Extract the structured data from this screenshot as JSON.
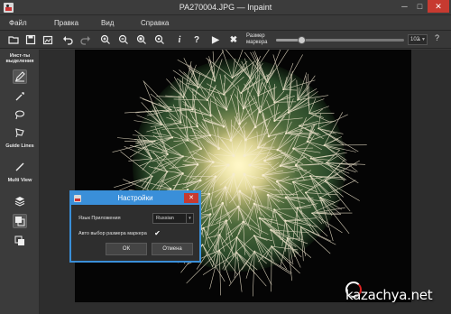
{
  "window": {
    "title": "PA270004.JPG — Inpaint",
    "min_glyph": "─",
    "max_glyph": "□",
    "close_glyph": "✕"
  },
  "menu": [
    {
      "label": "Файл"
    },
    {
      "label": "Правка"
    },
    {
      "label": "Вид"
    },
    {
      "label": "Справка"
    }
  ],
  "toolbar": {
    "icons": [
      "open-icon",
      "save-icon",
      "save-as-icon",
      "undo-icon",
      "redo-icon",
      "zoom-in-icon",
      "zoom-out-icon",
      "zoom-fit-icon",
      "zoom-actual-icon",
      "info-icon",
      "help-icon",
      "run-icon",
      "clear-icon"
    ],
    "info_glyph": "i",
    "help_glyph": "?",
    "run_glyph": "▶",
    "clear_glyph": "✖",
    "marker_label_1": "Размер",
    "marker_label_2": "маркера",
    "marker_size": "102",
    "marker_slider_fraction": 0.2,
    "spin_glyph": "▲▼",
    "help_button": "?"
  },
  "sidebar": {
    "tools_heading": "Инст-ты выделения",
    "guide_heading": "Guide Lines",
    "multiview_heading": "Multi View",
    "tool_icons": [
      "marker-icon",
      "magic-wand-icon",
      "lasso-icon",
      "polygon-lasso-icon",
      "line-icon",
      "layers-icon",
      "view-split-icon",
      "view-original-icon"
    ]
  },
  "dialog": {
    "title": "Настройки",
    "close_glyph": "✕",
    "language_label": "Язык Приложения",
    "language_value": "Russian",
    "select_arrow": "▾",
    "auto_marker_label": "Авто выбор размера маркера",
    "auto_marker_checked": "✔",
    "ok_label": "ОК",
    "cancel_label": "Отмена"
  },
  "watermark": {
    "text": "kazachya.net"
  },
  "colors": {
    "accent": "#3a8fd9",
    "close_red": "#c73a30",
    "background": "#3a3a3a"
  }
}
